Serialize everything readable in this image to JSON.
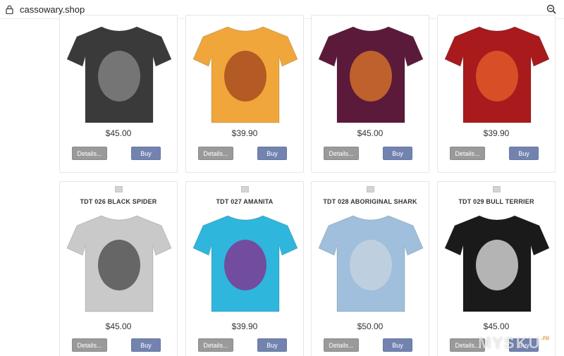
{
  "browser": {
    "url": "cassowary.shop"
  },
  "colors": {
    "details_button": "#9a9a9a",
    "buy_button": "#7383b0"
  },
  "products_row1": [
    {
      "title": "",
      "price": "$45.00",
      "shirt_color": "#3a3a3a",
      "art_color": "#8a8a8a",
      "details_label": "Details...",
      "buy_label": "Buy"
    },
    {
      "title": "",
      "price": "$39.90",
      "shirt_color": "#f0a63a",
      "art_color": "#a0401e",
      "details_label": "Details...",
      "buy_label": "Buy"
    },
    {
      "title": "",
      "price": "$45.00",
      "shirt_color": "#5c1a3a",
      "art_color": "#e07a2a",
      "details_label": "Details...",
      "buy_label": "Buy"
    },
    {
      "title": "",
      "price": "$39.90",
      "shirt_color": "#a81a1c",
      "art_color": "#e8602a",
      "details_label": "Details...",
      "buy_label": "Buy"
    }
  ],
  "products_row2": [
    {
      "title": "TDT 026 BLACK SPIDER",
      "price": "$45.00",
      "shirt_color": "#c9c9c9",
      "art_color": "#444444",
      "details_label": "Details...",
      "buy_label": "Buy"
    },
    {
      "title": "TDT 027 AMANITA",
      "price": "$39.90",
      "shirt_color": "#2fb6dd",
      "art_color": "#8a2a8a",
      "details_label": "Details...",
      "buy_label": "Buy"
    },
    {
      "title": "TDT 028 ABORIGINAL SHARK",
      "price": "$50.00",
      "shirt_color": "#9fbfdc",
      "art_color": "#c8d6e0",
      "details_label": "Details...",
      "buy_label": "Buy"
    },
    {
      "title": "TDT 029 BULL TERRIER",
      "price": "$45.00",
      "shirt_color": "#1a1a1a",
      "art_color": "#e8e8e8",
      "details_label": "Details...",
      "buy_label": "Buy"
    }
  ],
  "watermark": {
    "text": "MYSKU",
    "suffix": ".ru"
  }
}
